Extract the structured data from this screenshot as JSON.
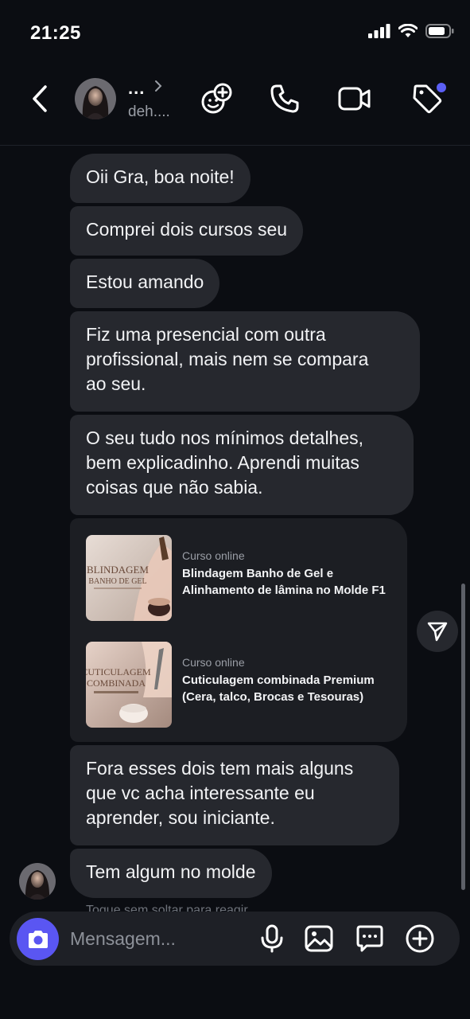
{
  "status_bar": {
    "time": "21:25"
  },
  "header": {
    "name": "...",
    "username": "deh....",
    "icons": [
      "chevron-left-icon",
      "add-people-icon",
      "phone-icon",
      "video-camera-icon",
      "tag-icon"
    ]
  },
  "messages": [
    {
      "text": "Oii Gra, boa noite!"
    },
    {
      "text": "Comprei dois cursos seu"
    },
    {
      "text": "Estou amando"
    },
    {
      "text": "Fiz uma presencial com outra\nprofissional, mais nem se compara\nao seu."
    },
    {
      "text": "O seu tudo nos mínimos detalhes,\nbem explicadinho. Aprendi muitas\ncoisas que não sabia."
    },
    {
      "text": "Fora esses dois tem mais alguns\nque vc acha interessante eu\naprender, sou iniciante."
    },
    {
      "text": "Tem algum no molde"
    }
  ],
  "courses": [
    {
      "kind": "Curso online",
      "title": "Blindagem Banho de Gel e Alinhamento de lâmina no Molde F1",
      "thumb_text_1": "BLINDAGEM",
      "thumb_text_2": "BANHO DE GEL"
    },
    {
      "kind": "Curso online",
      "title": "Cuticulagem combinada Premium (Cera, talco, Brocas e Tesouras)",
      "thumb_text_1": "CUTICULAGEM",
      "thumb_text_2": "COMBINADA"
    }
  ],
  "hint": "Toque sem soltar para reagir",
  "composer": {
    "placeholder": "Mensagem..."
  },
  "colors": {
    "accent": "#5a56f2",
    "bubble": "#26282e",
    "background": "#0b0d12",
    "notification_dot": "#5b5ff5"
  }
}
